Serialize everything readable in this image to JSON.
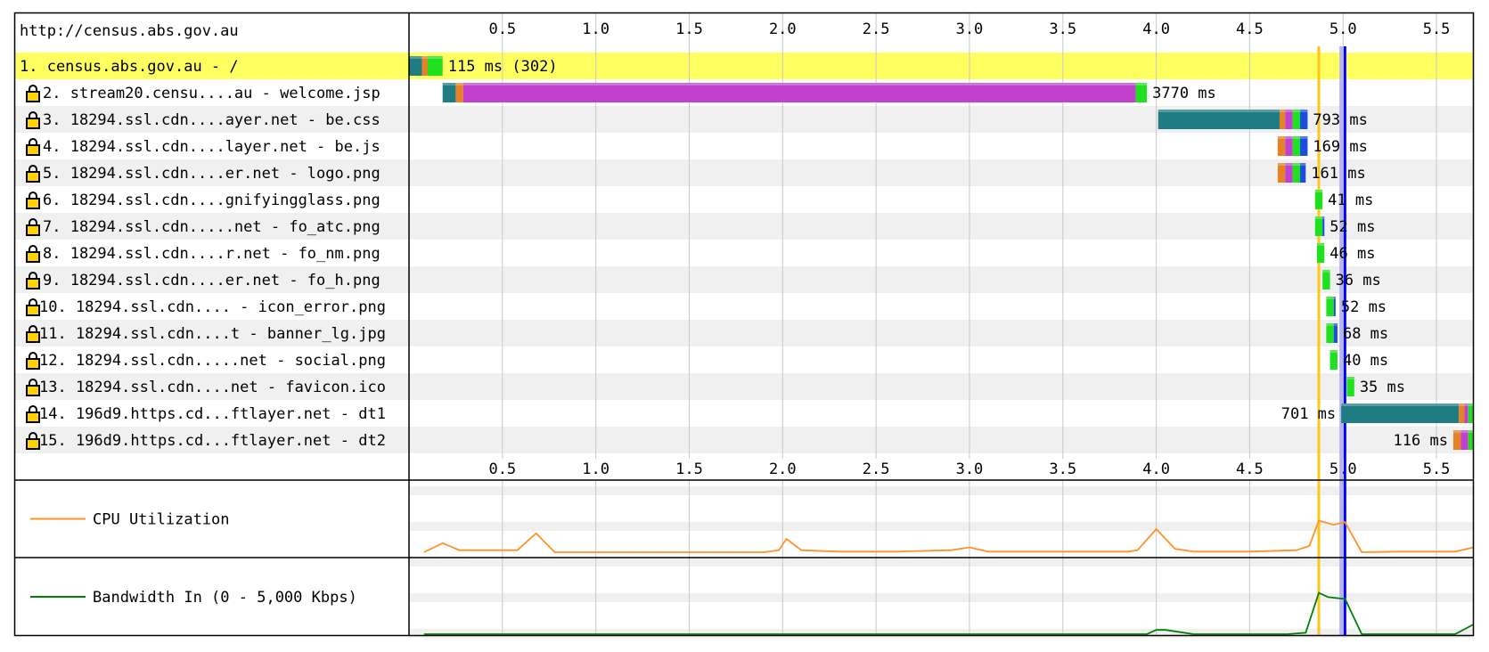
{
  "chart_data": {
    "type": "waterfall",
    "url": "http://census.abs.gov.au",
    "axis": {
      "xlim": [
        0,
        5.7
      ],
      "ticks": [
        "0.5",
        "1.0",
        "1.5",
        "2.0",
        "2.5",
        "3.0",
        "3.5",
        "4.0",
        "4.5",
        "5.0",
        "5.5"
      ]
    },
    "colors": {
      "dns": "#1f7c83",
      "connect": "#e58226",
      "ssl": "#c141cd",
      "wait": "#1fe11f",
      "download": "#1c4ce0",
      "ssl_lock": "#000000",
      "highlight_row": "#ffff60",
      "alt_row": "#f0f0f0",
      "start_render": "#ffc61a",
      "dom_loaded": "#b5b5f5",
      "on_load": "#0000ff",
      "cpu": "#ff9228",
      "bandwidth": "#008000"
    },
    "markers": {
      "start_render": 4.87,
      "dom_content_loaded": 4.99,
      "on_load": 5.01
    },
    "requests": [
      {
        "label": " 1. census.abs.gov.au - /",
        "secure": false,
        "highlight": true,
        "duration_label": "115 ms (302)",
        "label_side": "right",
        "segments": [
          {
            "p": "dns",
            "s": 0.0,
            "e": 0.07
          },
          {
            "p": "connect",
            "s": 0.07,
            "e": 0.1
          },
          {
            "p": "wait",
            "s": 0.1,
            "e": 0.18
          }
        ]
      },
      {
        "label": "2. stream20.censu....au - welcome.jsp",
        "secure": true,
        "highlight": false,
        "duration_label": "3770 ms",
        "label_side": "right",
        "segments": [
          {
            "p": "dns",
            "s": 0.18,
            "e": 0.25
          },
          {
            "p": "connect",
            "s": 0.25,
            "e": 0.29
          },
          {
            "p": "ssl",
            "s": 0.29,
            "e": 3.89
          },
          {
            "p": "wait",
            "s": 3.89,
            "e": 3.95
          }
        ]
      },
      {
        "label": "3. 18294.ssl.cdn....ayer.net - be.css",
        "secure": true,
        "highlight": false,
        "duration_label": "793 ms",
        "label_side": "right",
        "segments": [
          {
            "p": "dns",
            "s": 4.01,
            "e": 4.66
          },
          {
            "p": "connect",
            "s": 4.66,
            "e": 4.69
          },
          {
            "p": "ssl",
            "s": 4.69,
            "e": 4.73
          },
          {
            "p": "wait",
            "s": 4.73,
            "e": 4.77
          },
          {
            "p": "download",
            "s": 4.77,
            "e": 4.81
          }
        ]
      },
      {
        "label": "4. 18294.ssl.cdn....layer.net - be.js",
        "secure": true,
        "highlight": false,
        "duration_label": "169 ms",
        "label_side": "right",
        "segments": [
          {
            "p": "connect",
            "s": 4.65,
            "e": 4.69
          },
          {
            "p": "ssl",
            "s": 4.69,
            "e": 4.73
          },
          {
            "p": "wait",
            "s": 4.73,
            "e": 4.77
          },
          {
            "p": "download",
            "s": 4.77,
            "e": 4.81
          }
        ]
      },
      {
        "label": "5. 18294.ssl.cdn....er.net - logo.png",
        "secure": true,
        "highlight": false,
        "duration_label": "161 ms",
        "label_side": "right",
        "segments": [
          {
            "p": "connect",
            "s": 4.65,
            "e": 4.69
          },
          {
            "p": "ssl",
            "s": 4.69,
            "e": 4.73
          },
          {
            "p": "wait",
            "s": 4.73,
            "e": 4.77
          },
          {
            "p": "download",
            "s": 4.77,
            "e": 4.8
          }
        ]
      },
      {
        "label": "6. 18294.ssl.cdn....gnifyingglass.png",
        "secure": true,
        "highlight": false,
        "duration_label": "41 ms",
        "label_side": "right",
        "segments": [
          {
            "p": "wait",
            "s": 4.85,
            "e": 4.89
          }
        ]
      },
      {
        "label": "7. 18294.ssl.cdn.....net - fo_atc.png",
        "secure": true,
        "highlight": false,
        "duration_label": "52 ms",
        "label_side": "right",
        "segments": [
          {
            "p": "wait",
            "s": 4.85,
            "e": 4.89
          },
          {
            "p": "download",
            "s": 4.89,
            "e": 4.9
          }
        ]
      },
      {
        "label": "8. 18294.ssl.cdn....r.net - fo_nm.png",
        "secure": true,
        "highlight": false,
        "duration_label": "46 ms",
        "label_side": "right",
        "segments": [
          {
            "p": "wait",
            "s": 4.86,
            "e": 4.9
          }
        ]
      },
      {
        "label": "9. 18294.ssl.cdn....er.net - fo_h.png",
        "secure": true,
        "highlight": false,
        "duration_label": "36 ms",
        "label_side": "right",
        "segments": [
          {
            "p": "wait",
            "s": 4.89,
            "e": 4.93
          }
        ]
      },
      {
        "label": "10. 18294.ssl.cdn.... - icon_error.png",
        "secure": true,
        "highlight": false,
        "duration_label": "52 ms",
        "label_side": "right",
        "segments": [
          {
            "p": "wait",
            "s": 4.91,
            "e": 4.95
          },
          {
            "p": "download",
            "s": 4.95,
            "e": 4.96
          }
        ]
      },
      {
        "label": "11. 18294.ssl.cdn....t - banner_lg.jpg",
        "secure": true,
        "highlight": false,
        "duration_label": "68 ms",
        "label_side": "right",
        "segments": [
          {
            "p": "wait",
            "s": 4.91,
            "e": 4.95
          },
          {
            "p": "download",
            "s": 4.95,
            "e": 4.97
          }
        ]
      },
      {
        "label": "12. 18294.ssl.cdn.....net - social.png",
        "secure": true,
        "highlight": false,
        "duration_label": "40 ms",
        "label_side": "right",
        "segments": [
          {
            "p": "wait",
            "s": 4.93,
            "e": 4.97
          }
        ]
      },
      {
        "label": "13. 18294.ssl.cdn....net - favicon.ico",
        "secure": true,
        "highlight": false,
        "duration_label": "35 ms",
        "label_side": "right",
        "segments": [
          {
            "p": "wait",
            "s": 5.02,
            "e": 5.06
          }
        ]
      },
      {
        "label": "14. 196d9.https.cd...ftlayer.net - dt1",
        "secure": true,
        "highlight": false,
        "duration_label": "701 ms",
        "label_side": "left",
        "segments": [
          {
            "p": "dns",
            "s": 4.99,
            "e": 5.62
          },
          {
            "p": "connect",
            "s": 5.62,
            "e": 5.65
          },
          {
            "p": "ssl",
            "s": 5.65,
            "e": 5.67
          },
          {
            "p": "wait",
            "s": 5.67,
            "e": 5.7
          }
        ]
      },
      {
        "label": "15. 196d9.https.cd...ftlayer.net - dt2",
        "secure": true,
        "highlight": false,
        "duration_label": "116 ms",
        "label_side": "left",
        "segments": [
          {
            "p": "connect",
            "s": 5.59,
            "e": 5.63
          },
          {
            "p": "ssl",
            "s": 5.63,
            "e": 5.67
          },
          {
            "p": "wait",
            "s": 5.67,
            "e": 5.7
          }
        ]
      }
    ],
    "cpu": {
      "label": "CPU Utilization",
      "x": [
        0.08,
        0.18,
        0.27,
        0.45,
        0.58,
        0.68,
        0.78,
        0.95,
        1.5,
        1.9,
        1.98,
        2.02,
        2.1,
        2.3,
        2.6,
        2.9,
        3.0,
        3.1,
        3.3,
        3.6,
        3.85,
        3.9,
        4.0,
        4.1,
        4.2,
        4.5,
        4.75,
        4.82,
        4.87,
        4.95,
        5.01,
        5.1,
        5.3,
        5.5,
        5.6,
        5.7
      ],
      "y": [
        5,
        18,
        8,
        8,
        8,
        32,
        5,
        5,
        5,
        5,
        8,
        24,
        8,
        6,
        6,
        8,
        12,
        6,
        6,
        6,
        6,
        8,
        38,
        10,
        6,
        6,
        8,
        14,
        50,
        44,
        48,
        5,
        6,
        6,
        6,
        12
      ]
    },
    "bandwidth": {
      "label": "Bandwidth In (0 - 5,000 Kbps)",
      "x": [
        0.08,
        3.5,
        3.7,
        3.95,
        4.0,
        4.05,
        4.2,
        4.7,
        4.8,
        4.87,
        4.92,
        4.99,
        5.01,
        5.1,
        5.4,
        5.6,
        5.7
      ],
      "y": [
        0,
        0,
        0,
        0,
        6,
        6,
        0,
        0,
        2,
        58,
        52,
        50,
        50,
        0,
        0,
        0,
        14
      ]
    }
  }
}
